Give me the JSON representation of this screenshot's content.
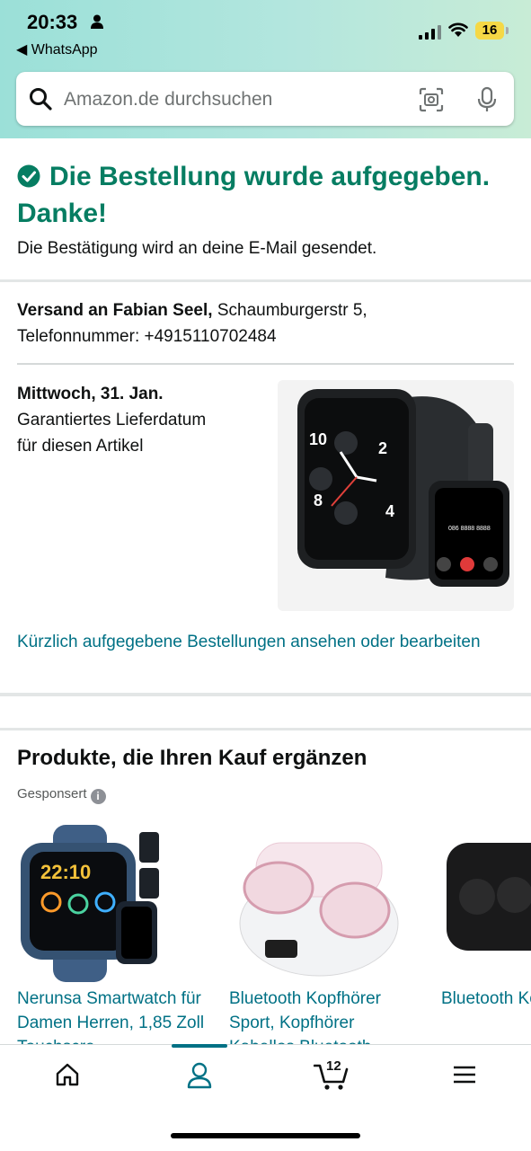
{
  "status_bar": {
    "time": "20:33",
    "back_app": "◀ WhatsApp",
    "battery": "16"
  },
  "search": {
    "placeholder": "Amazon.de durchsuchen"
  },
  "confirmation": {
    "title": "Die Bestellung wurde aufgegeben. Danke!",
    "subtitle": "Die Bestätigung wird an deine E-Mail gesendet."
  },
  "shipping": {
    "label": "Versand an Fabian Seel,",
    "address": " Schaumburgerstr 5,",
    "phone": "Telefonnummer: +4915110702484"
  },
  "delivery": {
    "date": "Mittwoch, 31. Jan.",
    "line1": "Garantiertes Lieferdatum",
    "line2": "für diesen Artikel"
  },
  "orders_link": "Kürzlich aufgegebene Bestellungen ansehen oder bearbeiten",
  "recommendations": {
    "title": "Produkte, die Ihren Kauf ergänzen",
    "sponsored": "Gesponsert",
    "items": [
      {
        "name": "Nerunsa Smartwatch für Damen Herren, 1,85 Zoll Touchscre"
      },
      {
        "name": "Bluetooth Kopfhörer Sport, Kopfhörer Kabellos Bluetooth"
      },
      {
        "name": "Bluetooth Kopfhörer Sport, In Ear Kopfhörer"
      }
    ]
  },
  "bottom_nav": {
    "cart_count": "12"
  },
  "colors": {
    "accent": "#007185",
    "success": "#067d62"
  }
}
